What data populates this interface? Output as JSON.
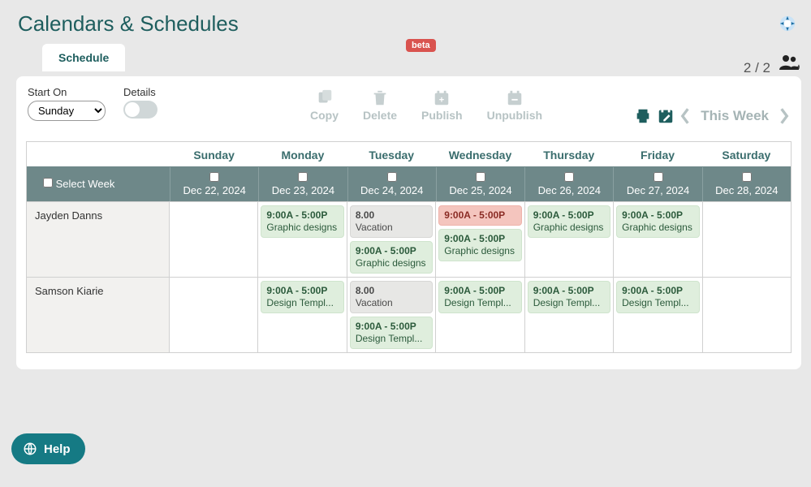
{
  "page_title": "Calendars & Schedules",
  "beta_label": "beta",
  "tab_label": "Schedule",
  "people_count": "2 / 2",
  "start_on": {
    "label": "Start On",
    "selected": "Sunday"
  },
  "details_label": "Details",
  "toolbar": {
    "copy": "Copy",
    "delete": "Delete",
    "publish": "Publish",
    "unpublish": "Unpublish"
  },
  "this_week": "This Week",
  "select_week_label": "Select Week",
  "days": [
    {
      "name": "Sunday",
      "date": "Dec 22, 2024"
    },
    {
      "name": "Monday",
      "date": "Dec 23, 2024"
    },
    {
      "name": "Tuesday",
      "date": "Dec 24, 2024"
    },
    {
      "name": "Wednesday",
      "date": "Dec 25, 2024"
    },
    {
      "name": "Thursday",
      "date": "Dec 26, 2024"
    },
    {
      "name": "Friday",
      "date": "Dec 27, 2024"
    },
    {
      "name": "Saturday",
      "date": "Dec 28, 2024"
    }
  ],
  "rows": [
    {
      "name": "Jayden Danns",
      "cells": [
        [],
        [
          {
            "l1": "9:00A - 5:00P",
            "l2": "Graphic designs",
            "style": "green"
          }
        ],
        [
          {
            "l1": "8.00",
            "l2": "Vacation",
            "style": "grey"
          },
          {
            "l1": "9:00A - 5:00P",
            "l2": "Graphic designs",
            "style": "green"
          }
        ],
        [
          {
            "l1": "9:00A - 5:00P",
            "l2": "",
            "style": "red"
          },
          {
            "l1": "9:00A - 5:00P",
            "l2": "Graphic designs",
            "style": "green"
          }
        ],
        [
          {
            "l1": "9:00A - 5:00P",
            "l2": "Graphic designs",
            "style": "green"
          }
        ],
        [
          {
            "l1": "9:00A - 5:00P",
            "l2": "Graphic designs",
            "style": "green"
          }
        ],
        []
      ]
    },
    {
      "name": "Samson Kiarie",
      "cells": [
        [],
        [
          {
            "l1": "9:00A - 5:00P",
            "l2": "Design Templ...",
            "style": "green"
          }
        ],
        [
          {
            "l1": "8.00",
            "l2": "Vacation",
            "style": "grey"
          },
          {
            "l1": "9:00A - 5:00P",
            "l2": "Design Templ...",
            "style": "green"
          }
        ],
        [
          {
            "l1": "9:00A - 5:00P",
            "l2": "Design Templ...",
            "style": "green"
          }
        ],
        [
          {
            "l1": "9:00A - 5:00P",
            "l2": "Design Templ...",
            "style": "green"
          }
        ],
        [
          {
            "l1": "9:00A - 5:00P",
            "l2": "Design Templ...",
            "style": "green"
          }
        ],
        []
      ]
    }
  ],
  "help_label": "Help"
}
